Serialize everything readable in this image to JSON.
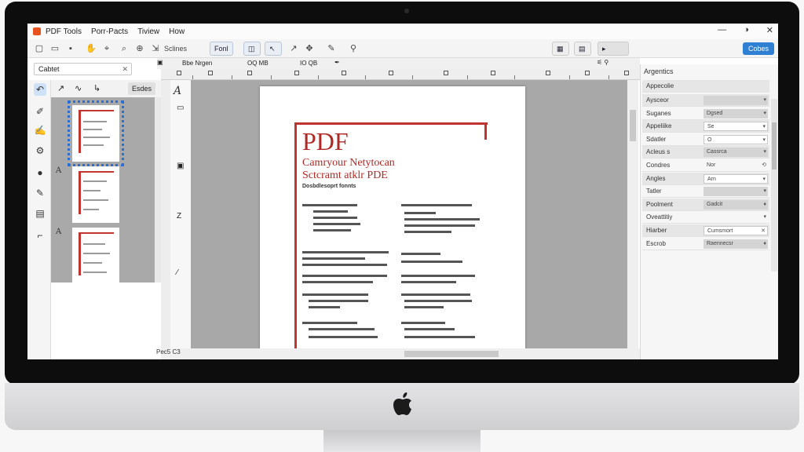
{
  "app": {
    "title": "PDF Tools",
    "menu": [
      "Porr-Pacts",
      "Tiview",
      "How"
    ],
    "window_controls": [
      "—",
      "◑",
      "✕"
    ]
  },
  "toolbar": {
    "icons": [
      "new-doc",
      "open-folder",
      "save",
      "hand",
      "search",
      "zoom",
      "select"
    ],
    "select_label": "Sclines",
    "form_label": "Fonl",
    "save_label": "Cobes",
    "row2_labels": [
      "Bbe Nrgen",
      "OQ MB",
      "IO QB"
    ]
  },
  "search": {
    "value": "Cabtet",
    "clear": "✕"
  },
  "subtools": {
    "edit_tab": "Esdes"
  },
  "thumbnails": {
    "letters": [
      "A",
      "A"
    ]
  },
  "canvas": {
    "corner_letter": "A",
    "page": {
      "heading": "PDF",
      "subtitle_1": "Camryour Netytocan",
      "subtitle_2": "Sctcramt atklr PDE",
      "small_caption": "Dosbdlesoprt fonnts"
    },
    "status_text": "Pec5 C3"
  },
  "properties": {
    "title": "Argentics",
    "header_row": "Appecolie",
    "rows": [
      {
        "label": "Aysceor",
        "value": "",
        "style": "grey",
        "arrow": "▾"
      },
      {
        "label": "Suganes",
        "value": "Dgsed",
        "style": "grey",
        "arrow": "▾"
      },
      {
        "label": "Appeliike",
        "value": "Se",
        "style": "box",
        "arrow": "▾"
      },
      {
        "label": "Sdatler",
        "value": "O",
        "style": "box",
        "arrow": "▾"
      },
      {
        "label": "Acleus s",
        "value": "Cassrca",
        "style": "grey",
        "arrow": "▾"
      },
      {
        "label": "Condres",
        "value": "Nor",
        "style": "plain",
        "arrow": "⟲"
      },
      {
        "label": "Angles",
        "value": "Arn",
        "style": "box",
        "arrow": "▾"
      },
      {
        "label": "Tatler",
        "value": "",
        "style": "grey",
        "arrow": "▾"
      },
      {
        "label": "Poolment",
        "value": "Gadcit",
        "style": "grey",
        "arrow": "♦"
      },
      {
        "label": "Oveattitiy",
        "value": "",
        "style": "plain",
        "arrow": "▾"
      },
      {
        "label": "Hiarber",
        "value": "Cumsmort",
        "style": "box",
        "arrow": "✕"
      },
      {
        "label": "Escrob",
        "value": "Raennecsr",
        "style": "grey",
        "arrow": "♦"
      }
    ]
  }
}
